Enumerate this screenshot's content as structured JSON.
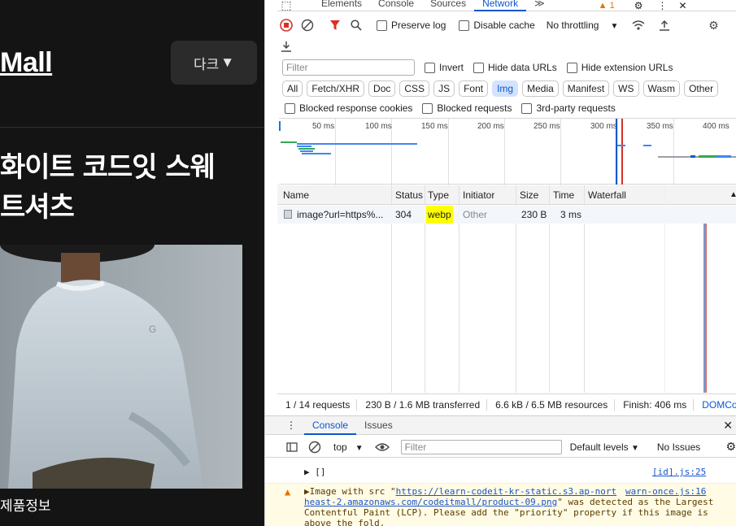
{
  "site": {
    "logo": "Mall",
    "theme_button": "다크",
    "theme_caret": "▼",
    "product_title_line1": "화이트 코드잇 스웨",
    "product_title_line2": "트셔츠",
    "product_info": "제품정보"
  },
  "devtools": {
    "tabs": [
      "Elements",
      "Console",
      "Sources",
      "Network"
    ],
    "more_tabs": "≫",
    "warning_count": "1",
    "toolbar": {
      "preserve_log": "Preserve log",
      "disable_cache": "Disable cache",
      "throttling": "No throttling"
    },
    "filter": {
      "placeholder": "Filter",
      "invert": "Invert",
      "hide_data_urls": "Hide data URLs",
      "hide_extension_urls": "Hide extension URLs"
    },
    "type_filters": [
      "All",
      "Fetch/XHR",
      "Doc",
      "CSS",
      "JS",
      "Font",
      "Img",
      "Media",
      "Manifest",
      "WS",
      "Wasm",
      "Other"
    ],
    "active_type": "Img",
    "block_filters": [
      "Blocked response cookies",
      "Blocked requests",
      "3rd-party requests"
    ],
    "timeline_ticks": [
      "50 ms",
      "100 ms",
      "150 ms",
      "200 ms",
      "250 ms",
      "300 ms",
      "350 ms",
      "400 ms"
    ],
    "table": {
      "headers": [
        "Name",
        "Status",
        "Type",
        "Initiator",
        "Size",
        "Time",
        "Waterfall"
      ],
      "rows": [
        {
          "name": "image?url=https%...",
          "status": "304",
          "type": "webp",
          "initiator": "Other",
          "size": "230 B",
          "time": "3 ms"
        }
      ]
    },
    "summary": [
      "1 / 14 requests",
      "230 B / 1.6 MB transferred",
      "6.6 kB / 6.5 MB resources",
      "Finish: 406 ms",
      "DOMCont"
    ],
    "drawer": {
      "tabs": [
        "Console",
        "Issues"
      ],
      "context": "top",
      "filter_placeholder": "Filter",
      "levels": "Default levels",
      "issues": "No Issues",
      "log1_text": "▶ []",
      "log1_src": "[id].js:25",
      "log2_prefix": "▶Image with src \"",
      "log2_url_a": "https://learn-codeit-kr-static.s3.ap-nort",
      "log2_src": "warn-once.js:16",
      "log2_url_b": "heast-2.amazonaws.com/codeitmall/product-09.png",
      "log2_rest1": "\" was detected as the Largest",
      "log2_rest2": "Contentful Paint (LCP). Please add the \"priority\" property if this image is",
      "log2_rest3": "above the fold."
    }
  }
}
